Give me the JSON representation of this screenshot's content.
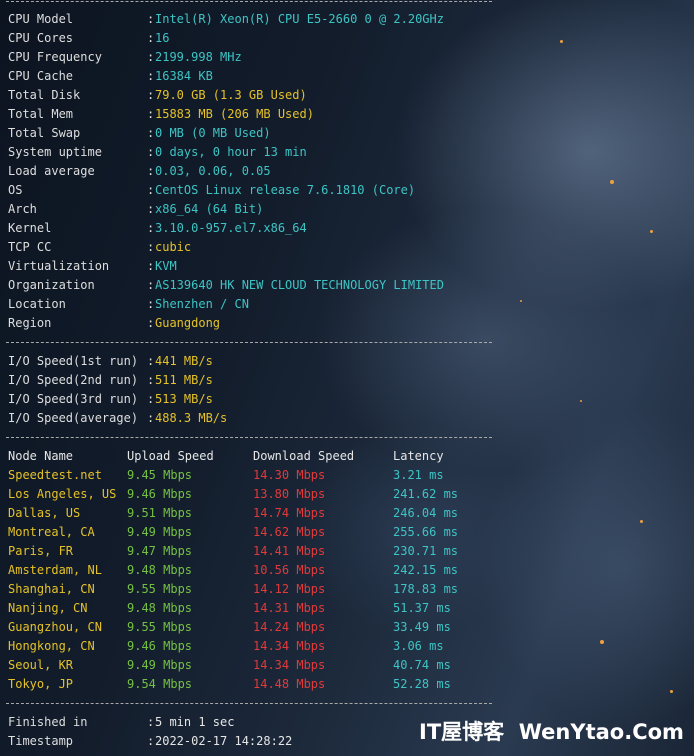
{
  "system_info": [
    {
      "key": "CPU Model",
      "value": "Intel(R) Xeon(R) CPU E5-2660 0 @ 2.20GHz",
      "color": "cyan"
    },
    {
      "key": "CPU Cores",
      "value": "16",
      "color": "cyan"
    },
    {
      "key": "CPU Frequency",
      "value": "2199.998 MHz",
      "color": "cyan"
    },
    {
      "key": "CPU Cache",
      "value": "16384 KB",
      "color": "cyan"
    },
    {
      "key": "Total Disk",
      "value": "79.0 GB (1.3 GB Used)",
      "color": "yellow"
    },
    {
      "key": "Total Mem",
      "value": "15883 MB (206 MB Used)",
      "color": "yellow"
    },
    {
      "key": "Total Swap",
      "value": "0 MB (0 MB Used)",
      "color": "cyan"
    },
    {
      "key": "System uptime",
      "value": "0 days, 0 hour 13 min",
      "color": "cyan"
    },
    {
      "key": "Load average",
      "value": "0.03, 0.06, 0.05",
      "color": "cyan"
    },
    {
      "key": "OS",
      "value": "CentOS Linux release 7.6.1810 (Core)",
      "color": "cyan"
    },
    {
      "key": "Arch",
      "value": "x86_64 (64 Bit)",
      "color": "cyan"
    },
    {
      "key": "Kernel",
      "value": "3.10.0-957.el7.x86_64",
      "color": "cyan"
    },
    {
      "key": "TCP CC",
      "value": "cubic",
      "color": "yellow"
    },
    {
      "key": "Virtualization",
      "value": "KVM",
      "color": "cyan"
    },
    {
      "key": "Organization",
      "value": "AS139640 HK NEW CLOUD TECHNOLOGY LIMITED",
      "color": "cyan"
    },
    {
      "key": "Location",
      "value": "Shenzhen / CN",
      "color": "cyan"
    },
    {
      "key": "Region",
      "value": "Guangdong",
      "color": "yellow"
    }
  ],
  "io_speed": [
    {
      "key": "I/O Speed(1st run)",
      "value": "441 MB/s"
    },
    {
      "key": "I/O Speed(2nd run)",
      "value": "511 MB/s"
    },
    {
      "key": "I/O Speed(3rd run)",
      "value": "513 MB/s"
    },
    {
      "key": "I/O Speed(average)",
      "value": "488.3 MB/s"
    }
  ],
  "speedtest": {
    "headers": [
      "Node Name",
      "Upload Speed",
      "Download Speed",
      "Latency"
    ],
    "rows": [
      [
        "Speedtest.net",
        "9.45 Mbps",
        "14.30 Mbps",
        "3.21 ms"
      ],
      [
        "Los Angeles, US",
        "9.46 Mbps",
        "13.80 Mbps",
        "241.62 ms"
      ],
      [
        "Dallas, US",
        "9.51 Mbps",
        "14.74 Mbps",
        "246.04 ms"
      ],
      [
        "Montreal, CA",
        "9.49 Mbps",
        "14.62 Mbps",
        "255.66 ms"
      ],
      [
        "Paris, FR",
        "9.47 Mbps",
        "14.41 Mbps",
        "230.71 ms"
      ],
      [
        "Amsterdam, NL",
        "9.48 Mbps",
        "10.56 Mbps",
        "242.15 ms"
      ],
      [
        "Shanghai, CN",
        "9.55 Mbps",
        "14.12 Mbps",
        "178.83 ms"
      ],
      [
        "Nanjing, CN",
        "9.48 Mbps",
        "14.31 Mbps",
        "51.37 ms"
      ],
      [
        "Guangzhou, CN",
        "9.55 Mbps",
        "14.24 Mbps",
        "33.49 ms"
      ],
      [
        "Hongkong, CN",
        "9.46 Mbps",
        "14.34 Mbps",
        "3.06 ms"
      ],
      [
        "Seoul, KR",
        "9.49 Mbps",
        "14.34 Mbps",
        "40.74 ms"
      ],
      [
        "Tokyo, JP",
        "9.54 Mbps",
        "14.48 Mbps",
        "52.28 ms"
      ]
    ]
  },
  "footer": [
    {
      "key": "Finished in",
      "value": "5 min 1 sec"
    },
    {
      "key": "Timestamp",
      "value": "2022-02-17 14:28:22"
    }
  ],
  "watermark": "IT屋博客  WenYtao.Com",
  "colors": {
    "cyan": "#3ec4c4",
    "yellow": "#e5c229",
    "green": "#75c043",
    "red": "#e03a3a"
  }
}
